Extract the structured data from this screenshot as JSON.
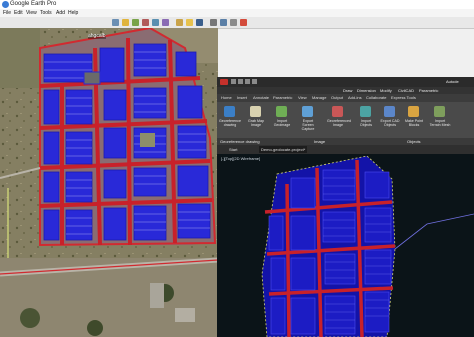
{
  "google_earth": {
    "title": "Google Earth Pro",
    "menu": [
      "File",
      "Edit",
      "View",
      "Tools",
      "Add",
      "Help"
    ],
    "map_label": "ahgcalb"
  },
  "autocad": {
    "title": "Autode",
    "menu": [
      "Draw",
      "Dimension",
      "Modify",
      "CivilCAD",
      "Parametric"
    ],
    "ribbon_tabs": [
      "Home",
      "Insert",
      "Annotate",
      "Parametric",
      "View",
      "Manage",
      "Output",
      "Add-ins",
      "Collaborate",
      "Express Tools"
    ],
    "ribbon_buttons": [
      {
        "label": "Georeference drawing",
        "icon": "globe-icon"
      },
      {
        "label": "Grab Map Image",
        "icon": "grab-icon"
      },
      {
        "label": "Import Geoimage",
        "icon": "image-import-icon"
      },
      {
        "label": "Export Screen Capture",
        "icon": "export-capture-icon"
      },
      {
        "label": "Georeferenced Image",
        "icon": "georef-image-icon"
      },
      {
        "label": "Import Objects",
        "icon": "import-objects-icon"
      },
      {
        "label": "Export CAD Objects",
        "icon": "export-cad-icon"
      },
      {
        "label": "Make Point Blocks",
        "icon": "point-blocks-icon"
      },
      {
        "label": "Import Terrain Mesh",
        "icon": "terrain-mesh-icon"
      }
    ],
    "panels": [
      "Georeference drawing",
      "Image",
      "Objects"
    ],
    "file_tabs": [
      "Start",
      "Demo-geolocate-project*"
    ],
    "viewport_label": "[-][Top][2D Wireframe]"
  },
  "colors": {
    "lot_outline": "#1f1fd6",
    "street": "#c8212a",
    "cad_background": "#0b1418"
  }
}
